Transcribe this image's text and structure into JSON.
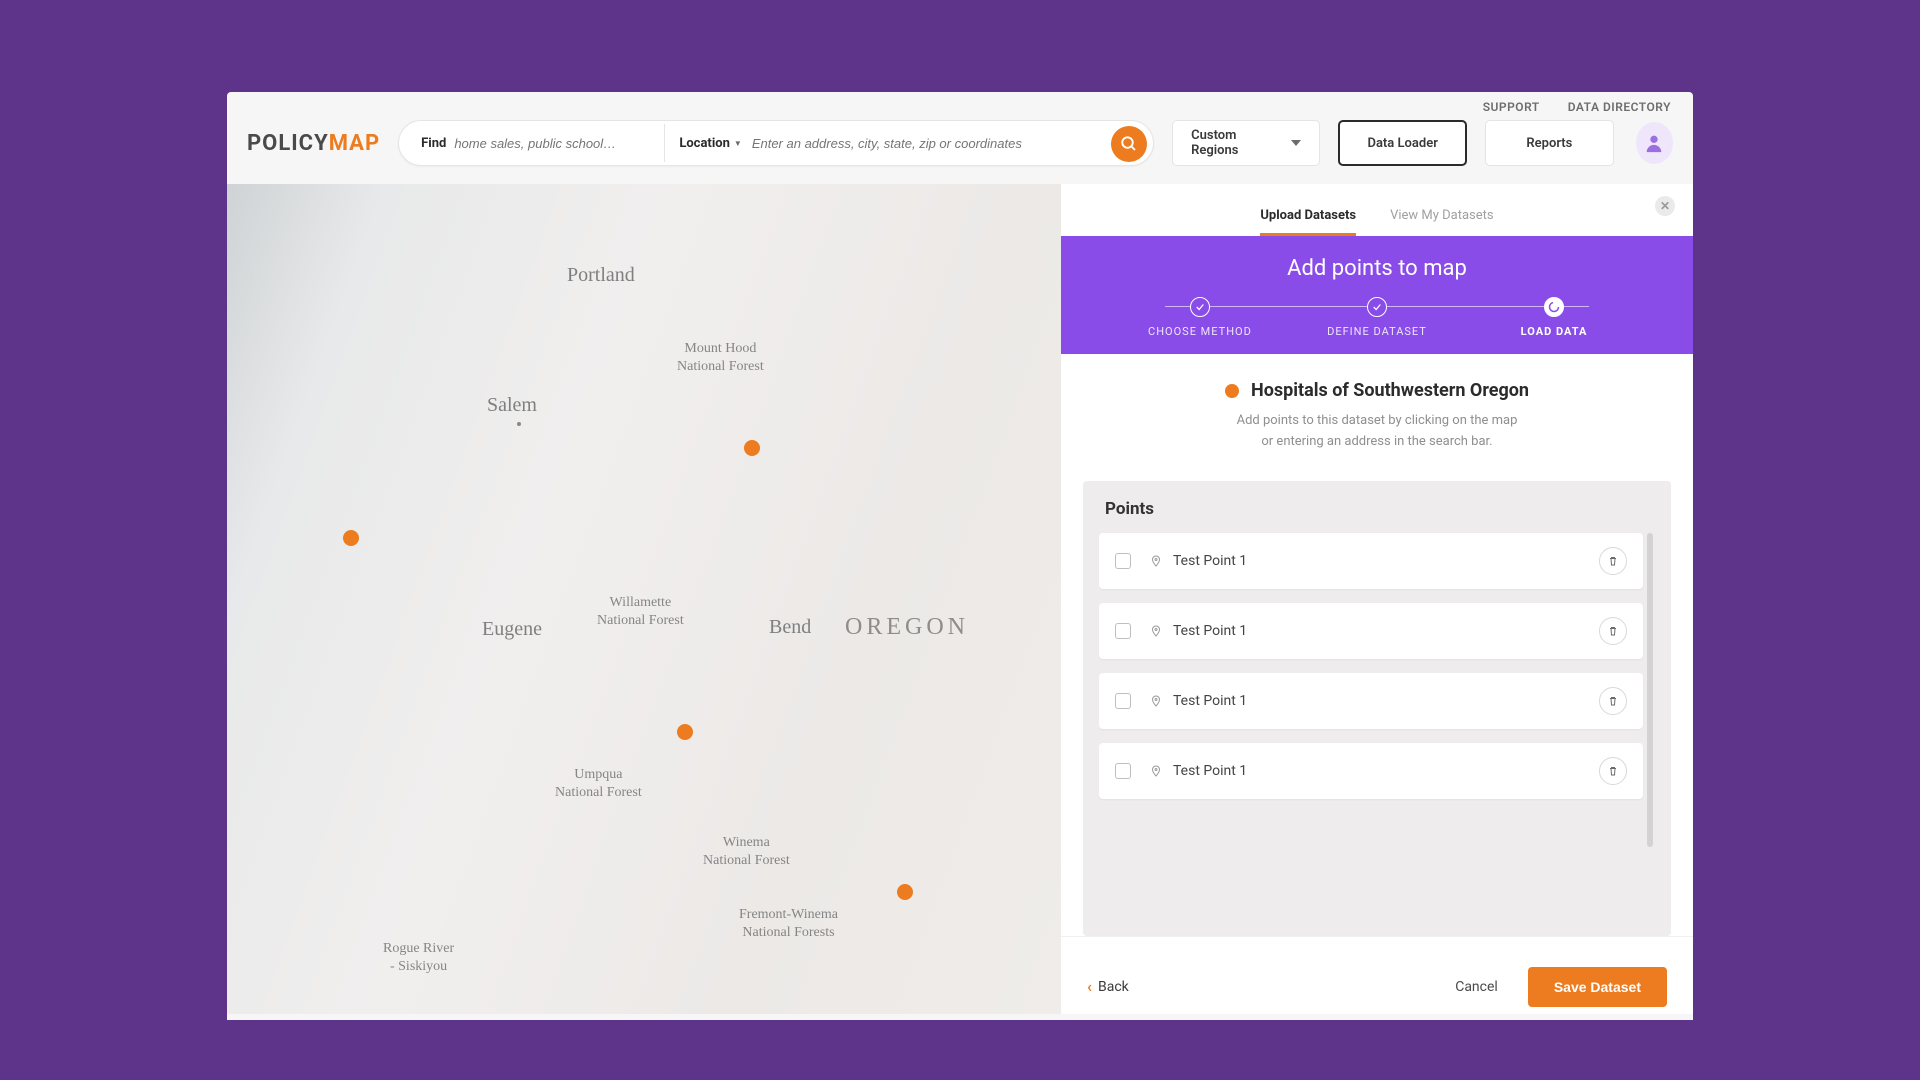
{
  "utility": {
    "support": "SUPPORT",
    "directory": "DATA DIRECTORY"
  },
  "logo": {
    "a": "POLICY",
    "b": "MAP"
  },
  "search": {
    "find_label": "Find",
    "find_placeholder": "home sales, public school…",
    "loc_label": "Location",
    "loc_placeholder": "Enter an address, city, state, zip or coordinates"
  },
  "nav": {
    "custom_regions": "Custom Regions",
    "data_loader": "Data Loader",
    "reports": "Reports"
  },
  "panel": {
    "tabs": {
      "upload": "Upload Datasets",
      "view": "View My Datasets"
    },
    "band_title": "Add points to map",
    "steps": {
      "s1": "CHOOSE METHOD",
      "s2": "DEFINE DATASET",
      "s3": "LOAD DATA"
    },
    "dataset_title": "Hospitals of Southwestern Oregon",
    "dataset_sub1": "Add points to this dataset by clicking on the map",
    "dataset_sub2": "or entering an address in the search bar.",
    "points_heading": "Points",
    "points": [
      {
        "name": "Test Point 1"
      },
      {
        "name": "Test Point 1"
      },
      {
        "name": "Test Point 1"
      },
      {
        "name": "Test Point 1"
      }
    ],
    "footer": {
      "back": "Back",
      "cancel": "Cancel",
      "save": "Save Dataset"
    }
  },
  "map": {
    "labels": {
      "portland": "Portland",
      "salem": "Salem",
      "eugene": "Eugene",
      "bend": "Bend",
      "oregon": "OREGON",
      "mthood": "Mount Hood\nNational Forest",
      "willamette": "Willamette\nNational Forest",
      "umpqua": "Umpqua\nNational Forest",
      "winema": "Winema\nNational Forest",
      "fremont": "Fremont-Winema\nNational Forests",
      "rogue": "Rogue River\n- Siskiyou"
    }
  }
}
